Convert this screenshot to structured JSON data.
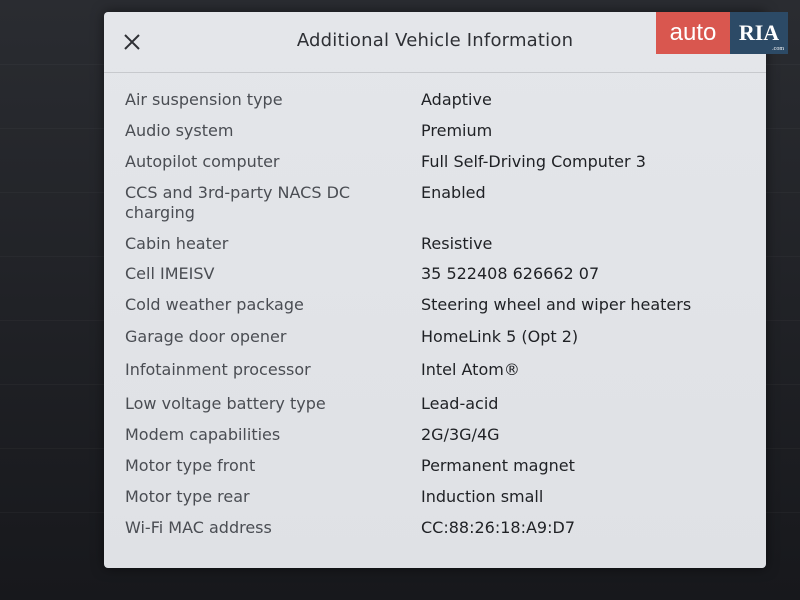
{
  "modal": {
    "title": "Additional Vehicle Information",
    "close_icon": "close-icon"
  },
  "specs": [
    {
      "label": "Air suspension type",
      "value": "Adaptive"
    },
    {
      "label": "Audio system",
      "value": "Premium"
    },
    {
      "label": "Autopilot computer",
      "value": "Full Self-Driving Computer 3"
    },
    {
      "label": "CCS and 3rd-party NACS DC charging",
      "value": "Enabled"
    },
    {
      "label": "Cabin heater",
      "value": "Resistive"
    },
    {
      "label": "Cell IMEISV",
      "value": "35 522408 626662 07"
    },
    {
      "label": "Cold weather package",
      "value": "Steering wheel and wiper heaters"
    },
    {
      "label": "Garage door opener",
      "value": "HomeLink 5 (Opt 2)"
    },
    {
      "label": "Infotainment processor",
      "value": "Intel Atom®"
    },
    {
      "label": "Low voltage battery type",
      "value": "Lead-acid"
    },
    {
      "label": "Modem capabilities",
      "value": "2G/3G/4G"
    },
    {
      "label": "Motor type front",
      "value": "Permanent magnet"
    },
    {
      "label": "Motor type rear",
      "value": "Induction small"
    },
    {
      "label": "Wi-Fi MAC address",
      "value": "CC:88:26:18:A9:D7"
    }
  ],
  "watermark": {
    "auto": "auto",
    "ria": "RIA",
    "domain": ".com"
  },
  "colors": {
    "modal_bg": "#e2e4e8",
    "label_text": "#4a4d53",
    "value_text": "#1f2125",
    "watermark_red": "#d9574f",
    "watermark_blue": "#2c4a66"
  }
}
